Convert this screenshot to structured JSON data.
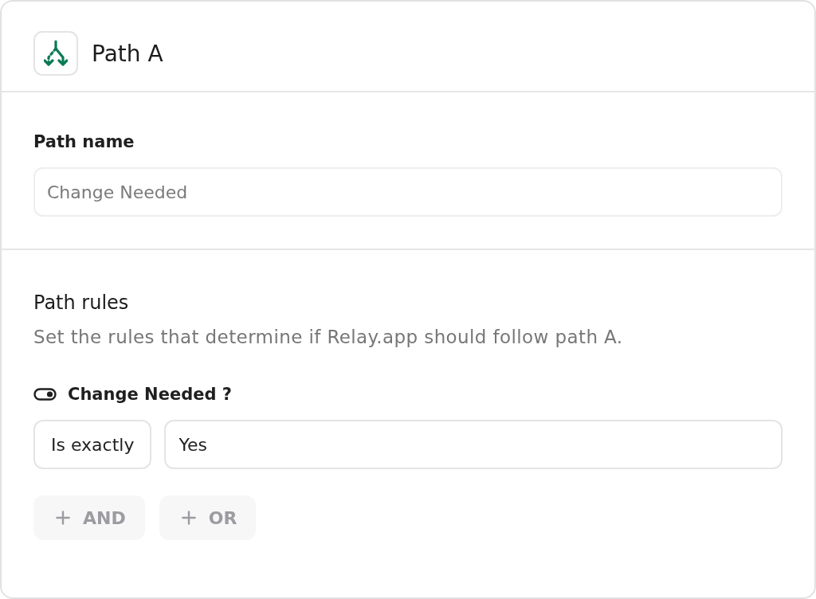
{
  "header": {
    "title": "Path A"
  },
  "path_name": {
    "label": "Path name",
    "placeholder": "Change Needed"
  },
  "path_rules": {
    "heading": "Path rules",
    "description": "Set the rules that determine if Relay.app should follow path A.",
    "conditions": [
      {
        "field": "Change Needed ?",
        "operator": "Is exactly",
        "value": "Yes"
      }
    ],
    "buttons": [
      {
        "label": "AND",
        "disabled": true
      },
      {
        "label": "OR",
        "disabled": true
      }
    ]
  }
}
